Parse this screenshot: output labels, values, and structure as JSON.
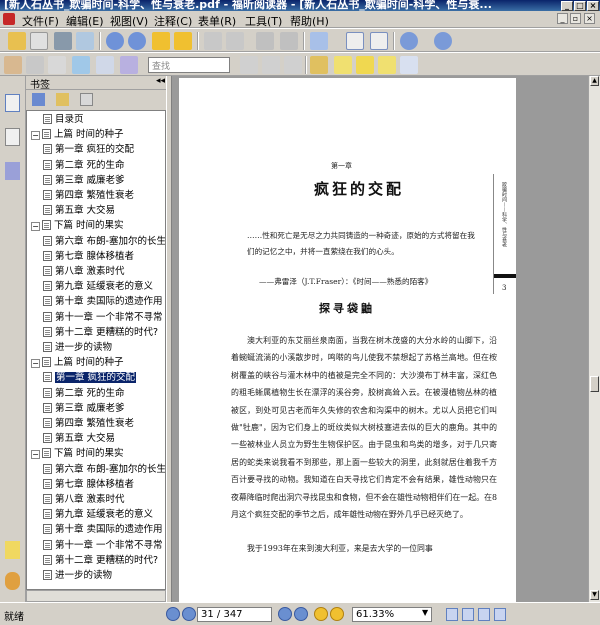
{
  "window": {
    "title": "[新人石丛书_欺骗时间-科学、性与衰老.pdf - 福昕阅读器 - [新人石丛书_欺骗时间-科学、性与衰..."
  },
  "menu": [
    "文件(F)",
    "编辑(E)",
    "视图(V)",
    "注释(C)",
    "表单(R)",
    "工具(T)",
    "帮助(H)"
  ],
  "toolbar": {
    "search_placeholder": "查找"
  },
  "bookmarks": {
    "header": "书签",
    "items": [
      {
        "label": "目录页",
        "level": 1,
        "toggle": ""
      },
      {
        "label": "上篇 时间的种子",
        "level": 0,
        "toggle": "-"
      },
      {
        "label": "第一章 疯狂的交配",
        "level": 1,
        "toggle": ""
      },
      {
        "label": "第二章 死的生命",
        "level": 1,
        "toggle": ""
      },
      {
        "label": "第三章 威廉老爹",
        "level": 1,
        "toggle": ""
      },
      {
        "label": "第四章 繁殖性衰老",
        "level": 1,
        "toggle": ""
      },
      {
        "label": "第五章 大交易",
        "level": 1,
        "toggle": ""
      },
      {
        "label": "下篇 时间的果实",
        "level": 0,
        "toggle": "-"
      },
      {
        "label": "第六章 布朗-塞加尔的长生",
        "level": 1,
        "toggle": ""
      },
      {
        "label": "第七章 腺体移植者",
        "level": 1,
        "toggle": ""
      },
      {
        "label": "第八章 激素时代",
        "level": 1,
        "toggle": ""
      },
      {
        "label": "第九章 延缓衰老的意义",
        "level": 1,
        "toggle": ""
      },
      {
        "label": "第十章 卖国际的遗迹作用",
        "level": 1,
        "toggle": ""
      },
      {
        "label": "第十一章 一个非常不寻常",
        "level": 1,
        "toggle": ""
      },
      {
        "label": "第十二章 更糟糕的时代?",
        "level": 1,
        "toggle": ""
      },
      {
        "label": "进一步的读物",
        "level": 1,
        "toggle": ""
      },
      {
        "label": "上篇 时间的种子",
        "level": 0,
        "toggle": "-"
      },
      {
        "label": "第一章 疯狂的交配",
        "level": 1,
        "toggle": "",
        "selected": true
      },
      {
        "label": "第二章 死的生命",
        "level": 1,
        "toggle": ""
      },
      {
        "label": "第三章 威廉老爹",
        "level": 1,
        "toggle": ""
      },
      {
        "label": "第四章 繁殖性衰老",
        "level": 1,
        "toggle": ""
      },
      {
        "label": "第五章 大交易",
        "level": 1,
        "toggle": ""
      },
      {
        "label": "下篇 时间的果实",
        "level": 0,
        "toggle": "-"
      },
      {
        "label": "第六章 布朗-塞加尔的长生",
        "level": 1,
        "toggle": ""
      },
      {
        "label": "第七章 腺体移植者",
        "level": 1,
        "toggle": ""
      },
      {
        "label": "第八章 激素时代",
        "level": 1,
        "toggle": ""
      },
      {
        "label": "第九章 延缓衰老的意义",
        "level": 1,
        "toggle": ""
      },
      {
        "label": "第十章 卖国际的遗迹作用",
        "level": 1,
        "toggle": ""
      },
      {
        "label": "第十一章 一个非常不寻常",
        "level": 1,
        "toggle": ""
      },
      {
        "label": "第十二章 更糟糕的时代?",
        "level": 1,
        "toggle": ""
      },
      {
        "label": "进一步的读物",
        "level": 1,
        "toggle": ""
      }
    ]
  },
  "page": {
    "chapter_number": "第一章",
    "chapter_title": "疯狂的交配",
    "quote": "……性和死亡是无尽之力共同铸造的一种奇迹，原始的方式将留在我们的记忆之中，并将一直萦绕在我们的心头。",
    "quote_source": "——弗雷泽（J.T.Fraser）：《时间——熟悉的陌客》",
    "section_title": "探寻袋鼬",
    "body": "澳大利亚的东艾丽丝泉南面，当我在树木茂盛的大分水岭的山脚下，沿着蜿蜒流淌的小溪散步时，鸣啭的鸟儿使我不禁想起了苏格兰高地。但在桉树覆盖的峡谷与灌木林中的植被是完全不同的：大沙漠布丁林丰富，深红色的粗毛蜥属植物生长在漂浮的溪谷旁，胶树高耸入云。在被漫植物丛林的植被区，到处可见古老而年久失修的农舍和沟渠中的树木。尤以人员把它们叫做\"牡鹿\"，因为它们身上的斑纹类似大树枝塞进去似的巨大的鹿角。其中的一些被林业人员立为野生生物保护区。由于昆虫和鸟类的增多，对于几只寄居的蛇类来说我看不到那些，那上面一些较大的洞里，此刻就居住着我千方百计要寻找的动物。我知道在白天寻找它们肯定不会有结果，雄性动物只在夜幕降临时爬出洞穴寻找昆虫和食物，但不会在雄性动物相伴们在一起。在8月这个疯狂交配的季节之后，成年雄性动物在野外几乎已经灭绝了。",
    "body2": "我于1993年在来到澳大利亚，来是去大学的一位同事",
    "running_head": "欺骗时间——科学、性与衰老",
    "page_no": "3"
  },
  "status": {
    "text": "就绪",
    "page_field": "31 / 347",
    "zoom": "61.33%"
  }
}
